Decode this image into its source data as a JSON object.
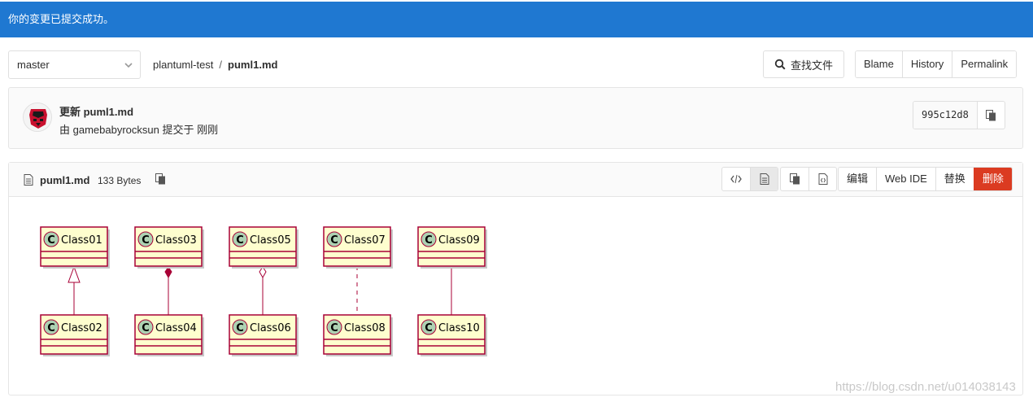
{
  "flash": {
    "message": "你的变更已提交成功。",
    "color": "#1f78d1"
  },
  "nav": {
    "branch": "master",
    "breadcrumb": {
      "project": "plantuml-test",
      "separator": "/",
      "file": "puml1.md"
    },
    "find_file_label": "查找文件",
    "file_actions": [
      "Blame",
      "History",
      "Permalink"
    ]
  },
  "commit": {
    "title": "更新 puml1.md",
    "meta": "由 gamebabyrocksun 提交于 刚刚",
    "sha": "995c12d8"
  },
  "file": {
    "name": "puml1.md",
    "size": "133 Bytes",
    "edit_buttons": {
      "edit": "编辑",
      "web_ide": "Web IDE",
      "replace": "替换",
      "delete": "删除"
    },
    "delete_color": "#db3b21"
  },
  "diagram": {
    "pairs": [
      {
        "top": "Class01",
        "bottom": "Class02",
        "relation": "extension"
      },
      {
        "top": "Class03",
        "bottom": "Class04",
        "relation": "composition"
      },
      {
        "top": "Class05",
        "bottom": "Class06",
        "relation": "aggregation"
      },
      {
        "top": "Class07",
        "bottom": "Class08",
        "relation": "dashed"
      },
      {
        "top": "Class09",
        "bottom": "Class10",
        "relation": "association"
      }
    ],
    "class_fill": "#fefece",
    "class_border": "#a80036",
    "circle_fill": "#add1b2",
    "circle_letter": "C"
  },
  "watermark": "https://blog.csdn.net/u014038143"
}
